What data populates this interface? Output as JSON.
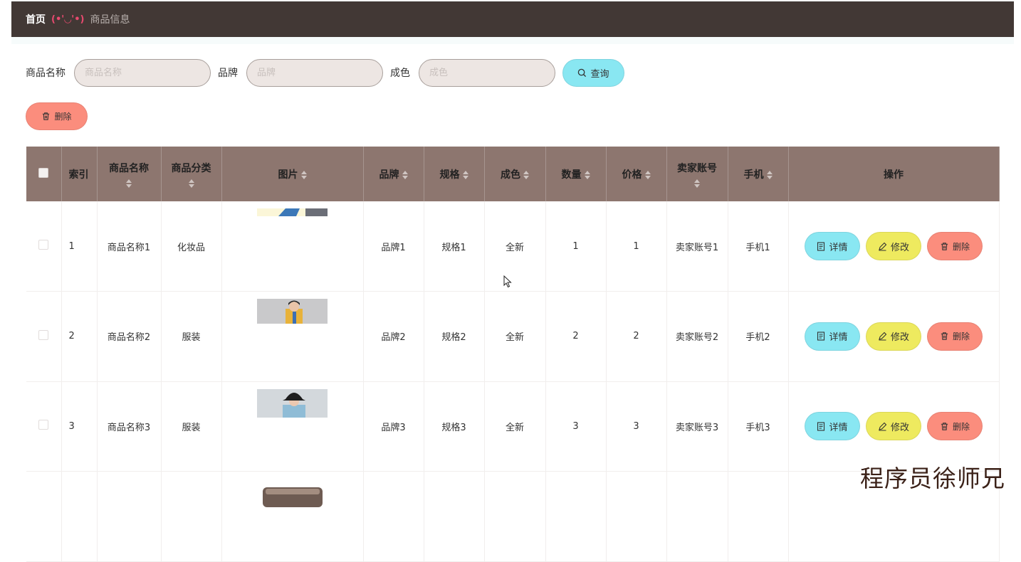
{
  "header": {
    "home": "首页",
    "separator": "(•'◡'•)",
    "current": "商品信息"
  },
  "search": {
    "name_label": "商品名称",
    "name_placeholder": "商品名称",
    "brand_label": "品牌",
    "brand_placeholder": "品牌",
    "condition_label": "成色",
    "condition_placeholder": "成色",
    "query_button": "查询"
  },
  "toolbar": {
    "delete_button": "删除"
  },
  "table": {
    "columns": {
      "index": "索引",
      "name": "商品名称",
      "category": "商品分类",
      "image": "图片",
      "brand": "品牌",
      "spec": "规格",
      "condition": "成色",
      "quantity": "数量",
      "price": "价格",
      "seller": "卖家账号",
      "phone": "手机",
      "actions": "操作"
    },
    "action_labels": {
      "detail": "详情",
      "edit": "修改",
      "delete": "删除"
    },
    "rows": [
      {
        "index": "1",
        "name": "商品名称1",
        "category": "化妆品",
        "brand": "品牌1",
        "spec": "规格1",
        "condition": "全新",
        "quantity": "1",
        "price": "1",
        "seller": "卖家账号1",
        "phone": "手机1"
      },
      {
        "index": "2",
        "name": "商品名称2",
        "category": "服装",
        "brand": "品牌2",
        "spec": "规格2",
        "condition": "全新",
        "quantity": "2",
        "price": "2",
        "seller": "卖家账号2",
        "phone": "手机2"
      },
      {
        "index": "3",
        "name": "商品名称3",
        "category": "服装",
        "brand": "品牌3",
        "spec": "规格3",
        "condition": "全新",
        "quantity": "3",
        "price": "3",
        "seller": "卖家账号3",
        "phone": "手机3"
      }
    ]
  },
  "watermark": "程序员徐师兄",
  "colors": {
    "header_bg": "#423835",
    "table_header_bg": "#8d766f",
    "input_bg": "#ede6e3",
    "query_button": "#89e7f2",
    "detail_button": "#89e7f2",
    "edit_button": "#eeea5f",
    "delete_button": "#fb8d7d"
  }
}
